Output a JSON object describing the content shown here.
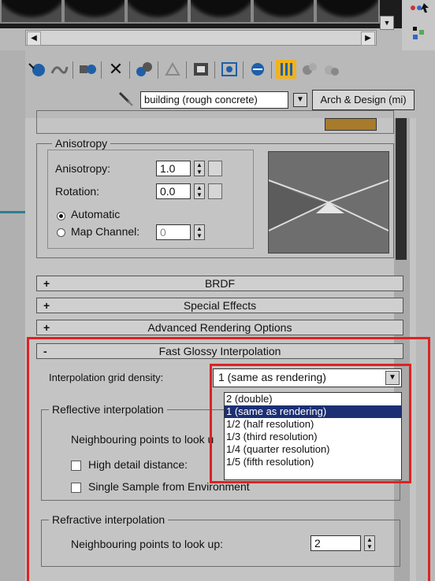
{
  "colors": {
    "highlight_red": "#d22222",
    "selection_blue": "#1c2f74",
    "panel_gray": "#c4c4c4"
  },
  "slots": {
    "count": 6
  },
  "toolbar": {
    "icons": [
      "get-material-icon",
      "put-to-scene-icon",
      "assign-to-selection-icon",
      "reset-map-icon",
      "make-unique-icon",
      "put-to-library-icon",
      "material-id-icon",
      "show-in-viewport-icon",
      "show-end-result-icon",
      "go-to-parent-icon",
      "go-forward-sibling-icon"
    ]
  },
  "material": {
    "name": "building (rough concrete)",
    "type": "Arch & Design (mi)"
  },
  "anisotropy": {
    "group_title": "Anisotropy",
    "anisotropy_label": "Anisotropy:",
    "anisotropy_value": "1.0",
    "rotation_label": "Rotation:",
    "rotation_value": "0.0",
    "automatic_label": "Automatic",
    "map_channel_label": "Map Channel:",
    "map_channel_value": "0"
  },
  "rollouts": [
    {
      "sign": "+",
      "title": "BRDF"
    },
    {
      "sign": "+",
      "title": "Special Effects"
    },
    {
      "sign": "+",
      "title": "Advanced Rendering Options"
    },
    {
      "sign": "-",
      "title": "Fast Glossy Interpolation"
    }
  ],
  "fgi": {
    "grid_density_label": "Interpolation grid density:",
    "grid_density_value": "1 (same as rendering)",
    "options": [
      "2 (double)",
      "1 (same as rendering)",
      "1/2 (half resolution)",
      "1/3 (third resolution)",
      "1/4 (quarter resolution)",
      "1/5 (fifth resolution)"
    ],
    "selected_index": 1,
    "reflective_title": "Reflective interpolation",
    "neighbouring_label_partial": "Neighbouring points to look u",
    "high_detail_label": "High detail distance:",
    "single_sample_label": "Single Sample from Environment",
    "refractive_title": "Refractive interpolation",
    "refractive_neighbouring_label": "Neighbouring points to look up:",
    "refractive_neighbouring_value": "2"
  }
}
